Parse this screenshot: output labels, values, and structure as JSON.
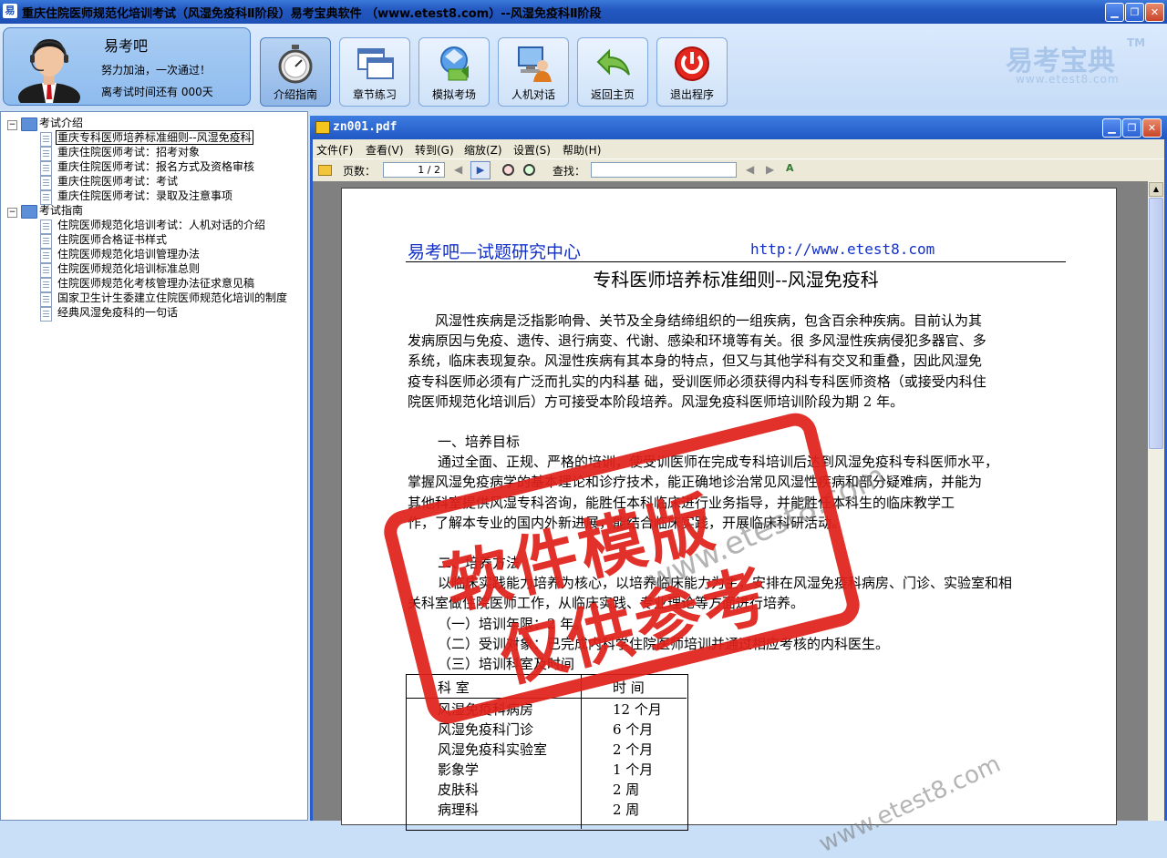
{
  "window": {
    "title": "重庆住院医师规范化培训考试（风湿免疫科Ⅱ阶段）易考宝典软件 （www.etest8.com）--风湿免疫科Ⅱ阶段",
    "icon_char": "易"
  },
  "profile": {
    "name": "易考吧",
    "motto": "努力加油，一次通过！",
    "countdown": "离考试时间还有 000天"
  },
  "toolbar": {
    "buttons": [
      {
        "label": "介绍指南",
        "icon": "stopwatch-icon"
      },
      {
        "label": "章节练习",
        "icon": "windows-icon"
      },
      {
        "label": "模拟考场",
        "icon": "exam-icon"
      },
      {
        "label": "人机对话",
        "icon": "computer-user-icon"
      },
      {
        "label": "返回主页",
        "icon": "return-arrow-icon"
      },
      {
        "label": "退出程序",
        "icon": "power-icon"
      }
    ]
  },
  "brand": {
    "name": "易考宝典",
    "tm": "TM",
    "url": "www.etest8.com"
  },
  "tree": {
    "groups": [
      {
        "label": "考试介绍",
        "items": [
          "重庆专科医师培养标准细则--风湿免疫科",
          "重庆住院医师考试：招考对象",
          "重庆住院医师考试：报名方式及资格审核",
          "重庆住院医师考试：考试",
          "重庆住院医师考试：录取及注意事项"
        ]
      },
      {
        "label": "考试指南",
        "items": [
          "住院医师规范化培训考试：人机对话的介绍",
          "住院医师合格证书样式",
          "住院医师规范化培训管理办法",
          "住院医师规范化培训标准总则",
          "住院医师规范化考核管理办法征求意见稿",
          "国家卫生计生委建立住院医师规范化培训的制度",
          "经典风湿免疫科的一句话"
        ]
      }
    ],
    "expander_open": "−"
  },
  "pdf": {
    "filename": "zn001.pdf",
    "menu": [
      "文件(F)",
      "查看(V)",
      "转到(G)",
      "缩放(Z)",
      "设置(S)",
      "帮助(H)"
    ],
    "page_label": "页数：",
    "page_value": "1 / 2",
    "find_label": "查找："
  },
  "document": {
    "header_left": "易考吧—试题研究中心",
    "header_right": "http://www.etest8.com",
    "title": "专科医师培养标准细则--风湿免疫科",
    "para1": [
      "风湿性疾病是泛指影响骨、关节及全身结缔组织的一组疾病，包含百余种疾病。目前认为其",
      "发病原因与免疫、遗传、退行病变、代谢、感染和环境等有关。很 多风湿性疾病侵犯多器官、多",
      "系统，临床表现复杂。风湿性疾病有其本身的特点，但又与其他学科有交叉和重叠，因此风湿免",
      "疫专科医师必须有广泛而扎实的内科基 础，受训医师必须获得内科专科医师资格（或接受内科住",
      "院医师规范化培训后）方可接受本阶段培养。风湿免疫科医师培训阶段为期 2 年。"
    ],
    "section1_title": "一、培养目标",
    "para2": [
      "通过全面、正规、严格的培训，使受训医师在完成专科培训后达到风湿免疫科专科医师水平，",
      "掌握风湿免疫病学的基本理论和诊疗技术，能正确地诊治常见风湿性疾病和部分疑难病，并能为",
      "其他科室提供风湿专科咨询，能胜任本科临床进行业务指导，并能胜任本科生的临床教学工",
      "作，了解本专业的国内外新进展，能结合临床实践，开展临床科研活动。"
    ],
    "section2_title": "二、培养方法",
    "para3": [
      "以临床实践能力培养为核心，以培养临床能力为主，安排在风湿免疫科病房、门诊、实验室和相",
      "关科室做住院医师工作，从临床实践、专业理论等方面进行培养。"
    ],
    "items": [
      "（一）培训年限：2 年。",
      "（二）受训对象：已完成内科学住院医师培训并通过相应考核的内科医生。",
      "（三）培训科室及时间"
    ],
    "table": {
      "header": [
        "科 室",
        "时 间"
      ],
      "rows": [
        [
          "风湿免疫科病房",
          "12 个月"
        ],
        [
          "风湿免疫科门诊",
          "6 个月"
        ],
        [
          "风湿免疫科实验室",
          "2 个月"
        ],
        [
          "影象学",
          "1 个月"
        ],
        [
          "皮肤科",
          "2 周"
        ],
        [
          "病理科",
          "2 周"
        ]
      ]
    }
  },
  "stamp": {
    "line1": "软件模版",
    "line2": "仅供参考",
    "color": "#e0211a"
  },
  "watermark": {
    "text": "www.etest8.com"
  },
  "colors": {
    "titlebar": "#2459c2",
    "link_blue": "#1230c8",
    "toolbar_bg": "#c5dbf6"
  }
}
